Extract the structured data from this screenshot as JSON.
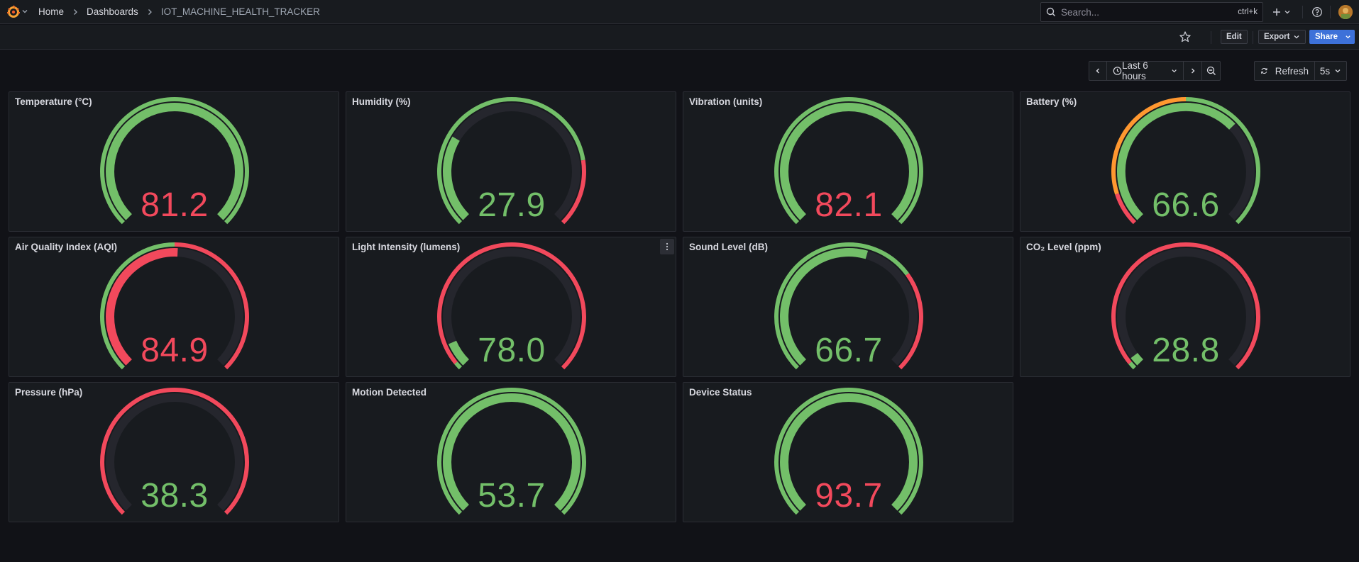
{
  "breadcrumb": {
    "home": "Home",
    "dashboards": "Dashboards",
    "current": "IOT_MACHINE_HEALTH_TRACKER"
  },
  "search": {
    "placeholder": "Search...",
    "shortcut": "ctrl+k"
  },
  "toolbar": {
    "edit_label": "Edit",
    "export_label": "Export",
    "share_label": "Share"
  },
  "time": {
    "range_label": "Last 6 hours",
    "refresh_label": "Refresh",
    "interval_label": "5s"
  },
  "colors": {
    "green": "#73bf69",
    "red": "#f2495c",
    "orange": "#ff9830",
    "track": "#25262d",
    "panel": "#181b1f",
    "accent_blue": "#3d71d9"
  },
  "panels": [
    {
      "title": "Temperature (°C)",
      "value": "81.2",
      "fraction": 1.0,
      "value_color": "#f2495c",
      "fill_color": "#73bf69",
      "thresholds": [
        {
          "frac": 1.0,
          "color": "#73bf69"
        }
      ]
    },
    {
      "title": "Humidity (%)",
      "value": "27.9",
      "fraction": 0.28,
      "value_color": "#73bf69",
      "fill_color": "#73bf69",
      "thresholds": [
        {
          "frac": 0.8,
          "color": "#73bf69"
        },
        {
          "frac": 1.0,
          "color": "#f2495c"
        }
      ]
    },
    {
      "title": "Vibration (units)",
      "value": "82.1",
      "fraction": 1.0,
      "value_color": "#f2495c",
      "fill_color": "#73bf69",
      "thresholds": [
        {
          "frac": 1.0,
          "color": "#73bf69"
        }
      ]
    },
    {
      "title": "Battery (%)",
      "value": "66.6",
      "fraction": 0.67,
      "value_color": "#73bf69",
      "fill_color": "#73bf69",
      "thresholds": [
        {
          "frac": 0.1,
          "color": "#f2495c"
        },
        {
          "frac": 0.5,
          "color": "#ff9830"
        },
        {
          "frac": 1.0,
          "color": "#73bf69"
        }
      ]
    },
    {
      "title": "Air Quality Index (AQI)",
      "value": "84.9",
      "fraction": 0.51,
      "value_color": "#f2495c",
      "fill_color": "#f2495c",
      "thresholds": [
        {
          "frac": 0.5,
          "color": "#73bf69"
        },
        {
          "frac": 1.0,
          "color": "#f2495c"
        }
      ]
    },
    {
      "title": "Light Intensity (lumens)",
      "value": "78.0",
      "fraction": 0.08,
      "value_color": "#73bf69",
      "fill_color": "#73bf69",
      "has_menu": true,
      "thresholds": [
        {
          "frac": 0.02,
          "color": "#73bf69"
        },
        {
          "frac": 1.0,
          "color": "#f2495c"
        }
      ]
    },
    {
      "title": "Sound Level (dB)",
      "value": "66.7",
      "fraction": 0.56,
      "value_color": "#73bf69",
      "fill_color": "#73bf69",
      "thresholds": [
        {
          "frac": 0.7,
          "color": "#73bf69"
        },
        {
          "frac": 1.0,
          "color": "#f2495c"
        }
      ]
    },
    {
      "title": "CO₂ Level (ppm)",
      "value": "28.8",
      "fraction": 0.03,
      "value_color": "#73bf69",
      "fill_color": "#73bf69",
      "thresholds": [
        {
          "frac": 0.02,
          "color": "#73bf69"
        },
        {
          "frac": 1.0,
          "color": "#f2495c"
        }
      ]
    },
    {
      "title": "Pressure (hPa)",
      "value": "38.3",
      "fraction": 0.0,
      "value_color": "#73bf69",
      "fill_color": "#73bf69",
      "thresholds": [
        {
          "frac": 1.0,
          "color": "#f2495c"
        }
      ]
    },
    {
      "title": "Motion Detected",
      "value": "53.7",
      "fraction": 1.0,
      "value_color": "#73bf69",
      "fill_color": "#73bf69",
      "thresholds": [
        {
          "frac": 1.0,
          "color": "#73bf69"
        }
      ]
    },
    {
      "title": "Device Status",
      "value": "93.7",
      "fraction": 1.0,
      "value_color": "#f2495c",
      "fill_color": "#73bf69",
      "thresholds": [
        {
          "frac": 1.0,
          "color": "#73bf69"
        }
      ]
    }
  ]
}
